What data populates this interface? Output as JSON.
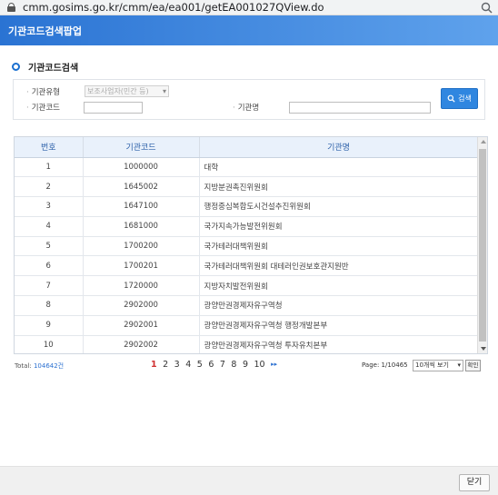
{
  "browser": {
    "url": "cmm.gosims.go.kr/cmm/ea/ea001/getEA001027QView.do",
    "lock_icon": "lock-icon",
    "zoom_icon": "magnifier-icon"
  },
  "window": {
    "title": "기관코드검색팝업"
  },
  "search": {
    "section_title": "기관코드검색",
    "type_label": "기관유형",
    "type_value": "보조사업자(민간 등)",
    "code_label": "기관코드",
    "code_value": "",
    "name_label": "기관명",
    "name_value": "",
    "button_label": "검색"
  },
  "table": {
    "columns": [
      "번호",
      "기관코드",
      "기관명"
    ],
    "rows": [
      [
        "1",
        "1000000",
        "대학"
      ],
      [
        "2",
        "1645002",
        "지방분권촉진위원회"
      ],
      [
        "3",
        "1647100",
        "행정중심복합도시건설추진위원회"
      ],
      [
        "4",
        "1681000",
        "국가지속가능발전위원회"
      ],
      [
        "5",
        "1700200",
        "국가테러대책위원회"
      ],
      [
        "6",
        "1700201",
        "국가테러대책위원회 대테러인권보호관지원반"
      ],
      [
        "7",
        "1720000",
        "지방자치발전위원회"
      ],
      [
        "8",
        "2902000",
        "광양만권경제자유구역청"
      ],
      [
        "9",
        "2902001",
        "광양만권경제자유구역청 행정개발본부"
      ],
      [
        "10",
        "2902002",
        "광양만권경제자유구역청 투자유치본부"
      ]
    ]
  },
  "pagination": {
    "total_label": "Total:",
    "total_value": "104642건",
    "pages": [
      "1",
      "2",
      "3",
      "4",
      "5",
      "6",
      "7",
      "8",
      "9",
      "10"
    ],
    "current_page": "1",
    "next_label": "▸▸",
    "page_info": "Page: 1/10465",
    "per_page": "10개씩 보기",
    "go_label": "확인"
  },
  "footer": {
    "close_label": "닫기"
  },
  "colors": {
    "accent": "#2f86e0",
    "title_bar": "#2a73d3",
    "current_page": "#d03030"
  }
}
